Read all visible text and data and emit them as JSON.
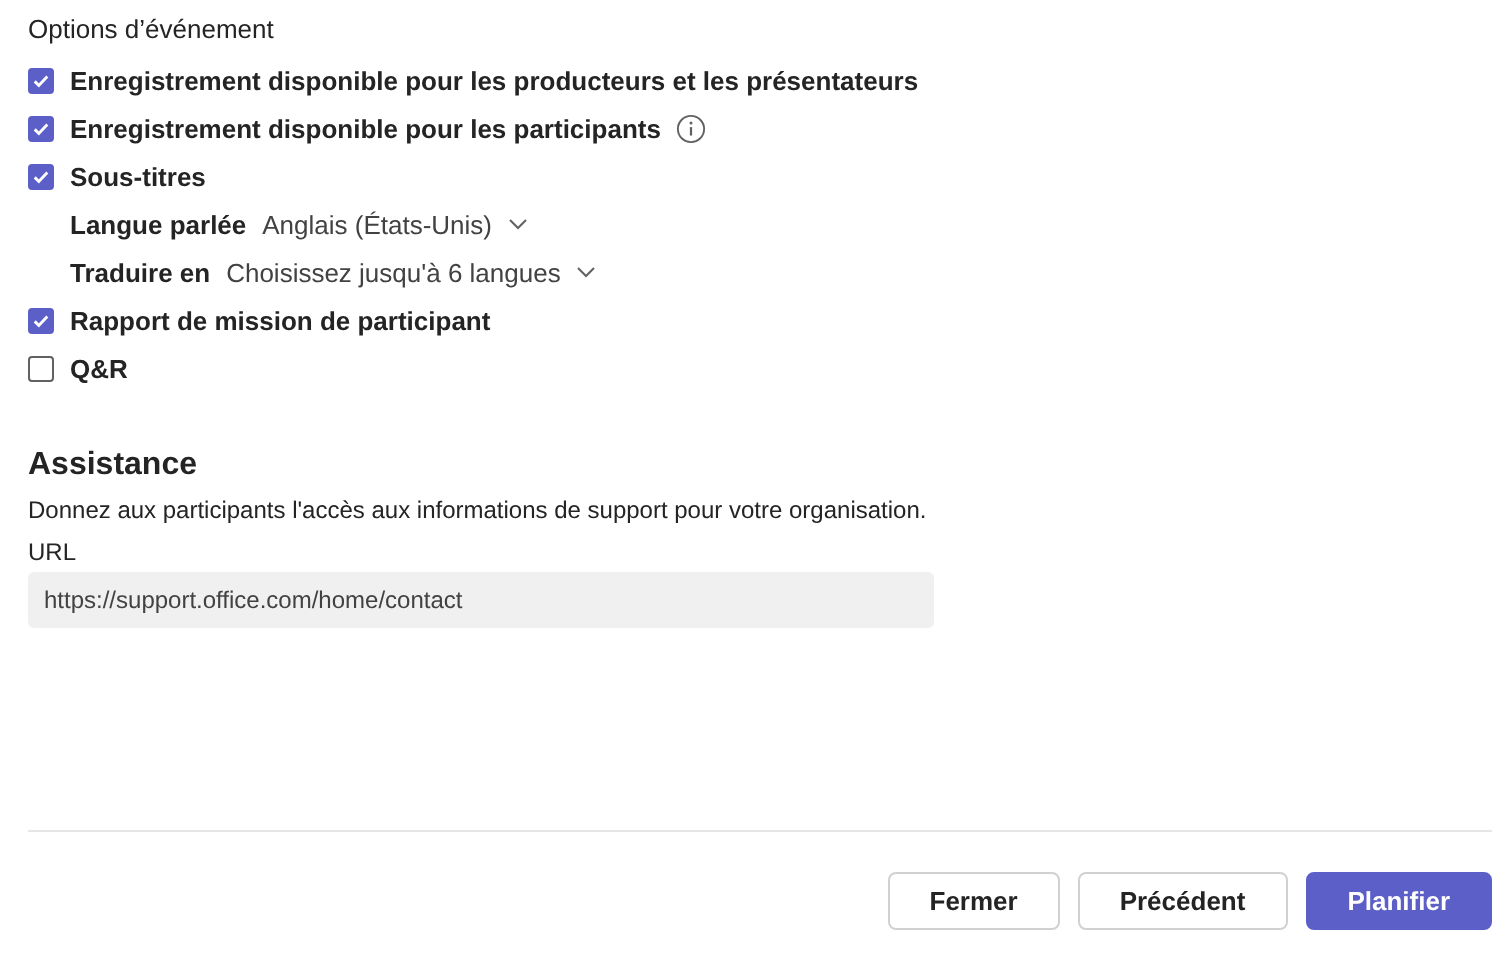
{
  "event_options": {
    "title": "Options d’événement",
    "items": [
      {
        "kind": "checkbox",
        "label": "Enregistrement disponible pour les producteurs et les présentateurs",
        "checked": true
      },
      {
        "kind": "checkbox",
        "label": "Enregistrement disponible pour les participants",
        "checked": true,
        "info": true
      },
      {
        "kind": "checkbox",
        "label": "Sous-titres",
        "checked": true
      },
      {
        "kind": "select",
        "label": "Langue parlée",
        "value": "Anglais (États-Unis)"
      },
      {
        "kind": "select",
        "label": "Traduire en",
        "value": "Choisissez jusqu'à 6 langues"
      },
      {
        "kind": "checkbox",
        "label": "Rapport de mission de participant",
        "checked": true
      },
      {
        "kind": "checkbox",
        "label": "Q&R",
        "checked": false
      }
    ]
  },
  "assistance": {
    "title": "Assistance",
    "description": "Donnez aux participants l'accès aux informations de support pour votre organisation.",
    "url_label": "URL",
    "url_value": "https://support.office.com/home/contact"
  },
  "buttons": [
    {
      "label": "Fermer",
      "kind": "secondary"
    },
    {
      "label": "Précédent",
      "kind": "secondary"
    },
    {
      "label": "Planifier",
      "kind": "primary"
    }
  ]
}
